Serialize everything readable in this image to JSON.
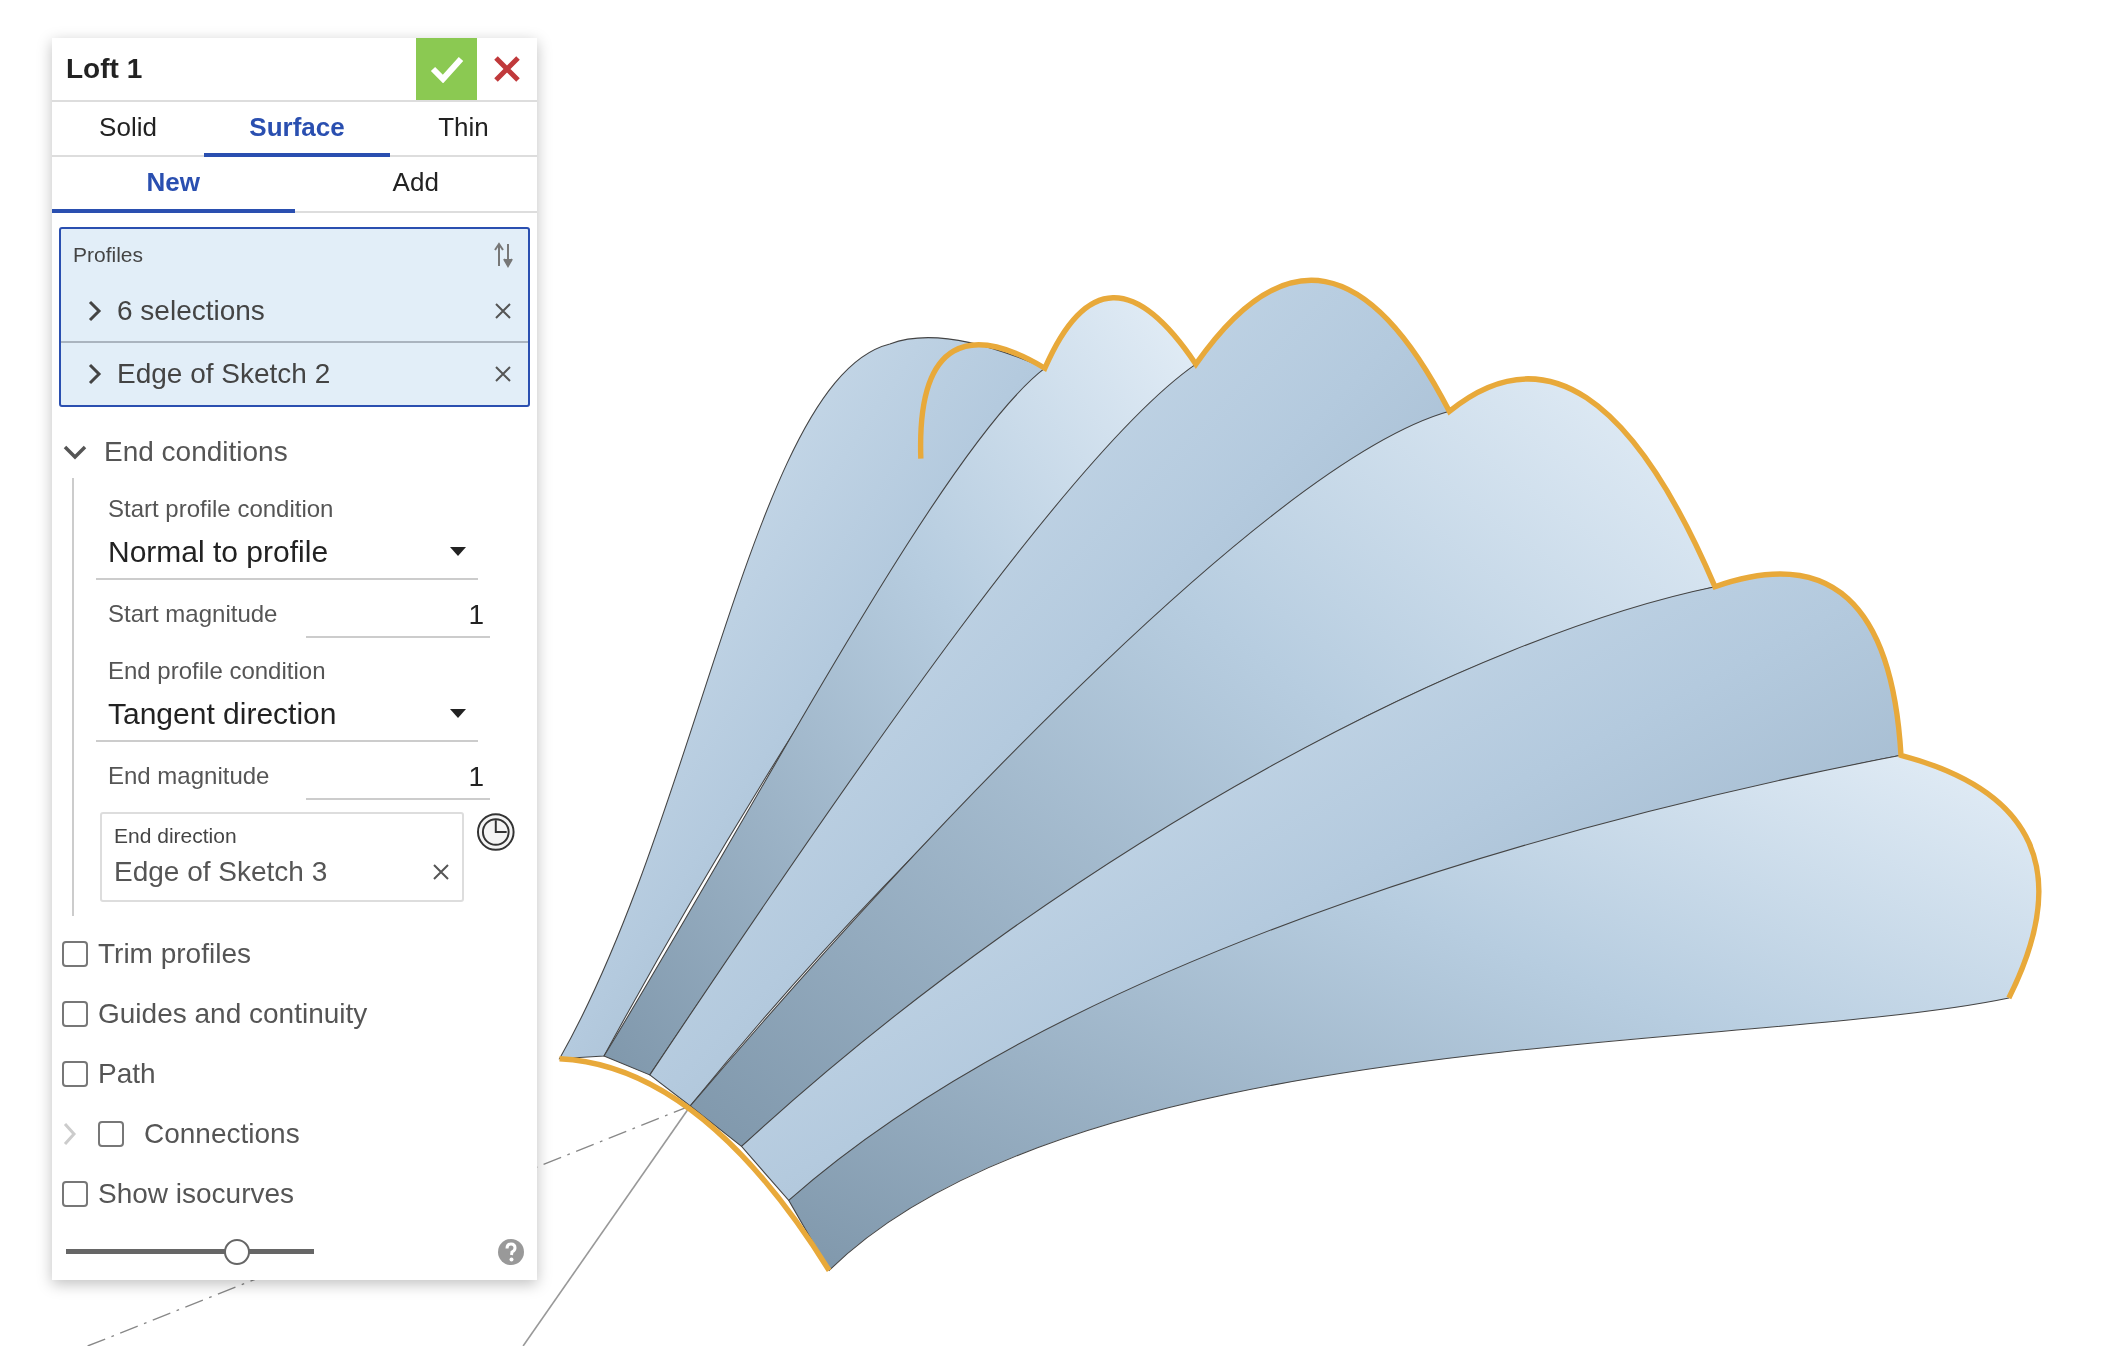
{
  "panel": {
    "title": "Loft 1"
  },
  "type_tabs": [
    {
      "label": "Solid",
      "selected": false
    },
    {
      "label": "Surface",
      "selected": true
    },
    {
      "label": "Thin",
      "selected": false
    }
  ],
  "operation_tabs": [
    {
      "label": "New",
      "selected": true
    },
    {
      "label": "Add",
      "selected": false
    }
  ],
  "profiles": {
    "label": "Profiles",
    "selections": [
      {
        "text": "6 selections"
      },
      {
        "text": "Edge of Sketch 2"
      }
    ]
  },
  "end_conditions": {
    "label": "End conditions",
    "expanded": true,
    "start_condition": {
      "label": "Start profile condition",
      "value": "Normal to profile"
    },
    "start_magnitude": {
      "label": "Start magnitude",
      "value": "1"
    },
    "end_condition": {
      "label": "End profile condition",
      "value": "Tangent direction"
    },
    "end_magnitude": {
      "label": "End magnitude",
      "value": "1"
    },
    "end_direction": {
      "label": "End direction",
      "value": "Edge of Sketch 3"
    }
  },
  "options": [
    {
      "label": "Trim profiles",
      "checked": false,
      "kind": "checkbox"
    },
    {
      "label": "Guides and continuity",
      "checked": false,
      "kind": "checkbox"
    },
    {
      "label": "Path",
      "checked": false,
      "kind": "checkbox"
    },
    {
      "label": "Connections",
      "checked": false,
      "kind": "expandable"
    },
    {
      "label": "Show isocurves",
      "checked": false,
      "kind": "checkbox"
    }
  ],
  "slider": {
    "level": 0.69
  }
}
